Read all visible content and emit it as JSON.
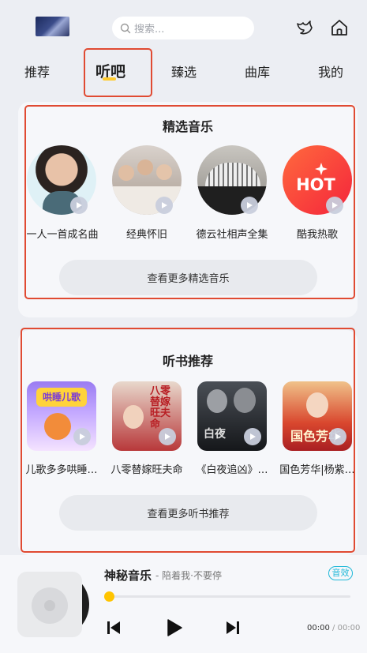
{
  "header": {
    "search_placeholder": "搜索...",
    "icons": [
      "avatar",
      "search-icon",
      "bird-icon",
      "home-icon"
    ]
  },
  "tabs": [
    {
      "label": "推荐",
      "active": false
    },
    {
      "label": "听吧",
      "active": true
    },
    {
      "label": "臻选",
      "active": false
    },
    {
      "label": "曲库",
      "active": false
    },
    {
      "label": "我的",
      "active": false
    }
  ],
  "featured": {
    "title": "精选音乐",
    "items": [
      {
        "label": "一人一首成名曲"
      },
      {
        "label": "经典怀旧"
      },
      {
        "label": "德云社相声全集"
      },
      {
        "label": "酷我热歌",
        "cover_text": "HOT"
      }
    ],
    "more_label": "查看更多精选音乐"
  },
  "audiobooks": {
    "title": "听书推荐",
    "items": [
      {
        "label": "儿歌多多哄睡…",
        "cover_text": "哄睡儿歌"
      },
      {
        "label": "八零替嫁旺夫命",
        "cover_text": "八零替嫁旺夫命"
      },
      {
        "label": "《白夜追凶》…",
        "cover_text": "白夜"
      },
      {
        "label": "国色芳华|杨紫…",
        "cover_text": "国色芳华"
      }
    ],
    "more_label": "查看更多听书推荐"
  },
  "player": {
    "title": "神秘音乐",
    "subtitle": "- 陪着我·不要停",
    "effect_badge": "音效",
    "progress": 0,
    "time_current": "00:00",
    "time_separator": "/",
    "time_total": "00:00"
  },
  "colors": {
    "accent": "#ffcb2f",
    "highlight_box": "#e04a32",
    "badge": "#20b8d8"
  }
}
